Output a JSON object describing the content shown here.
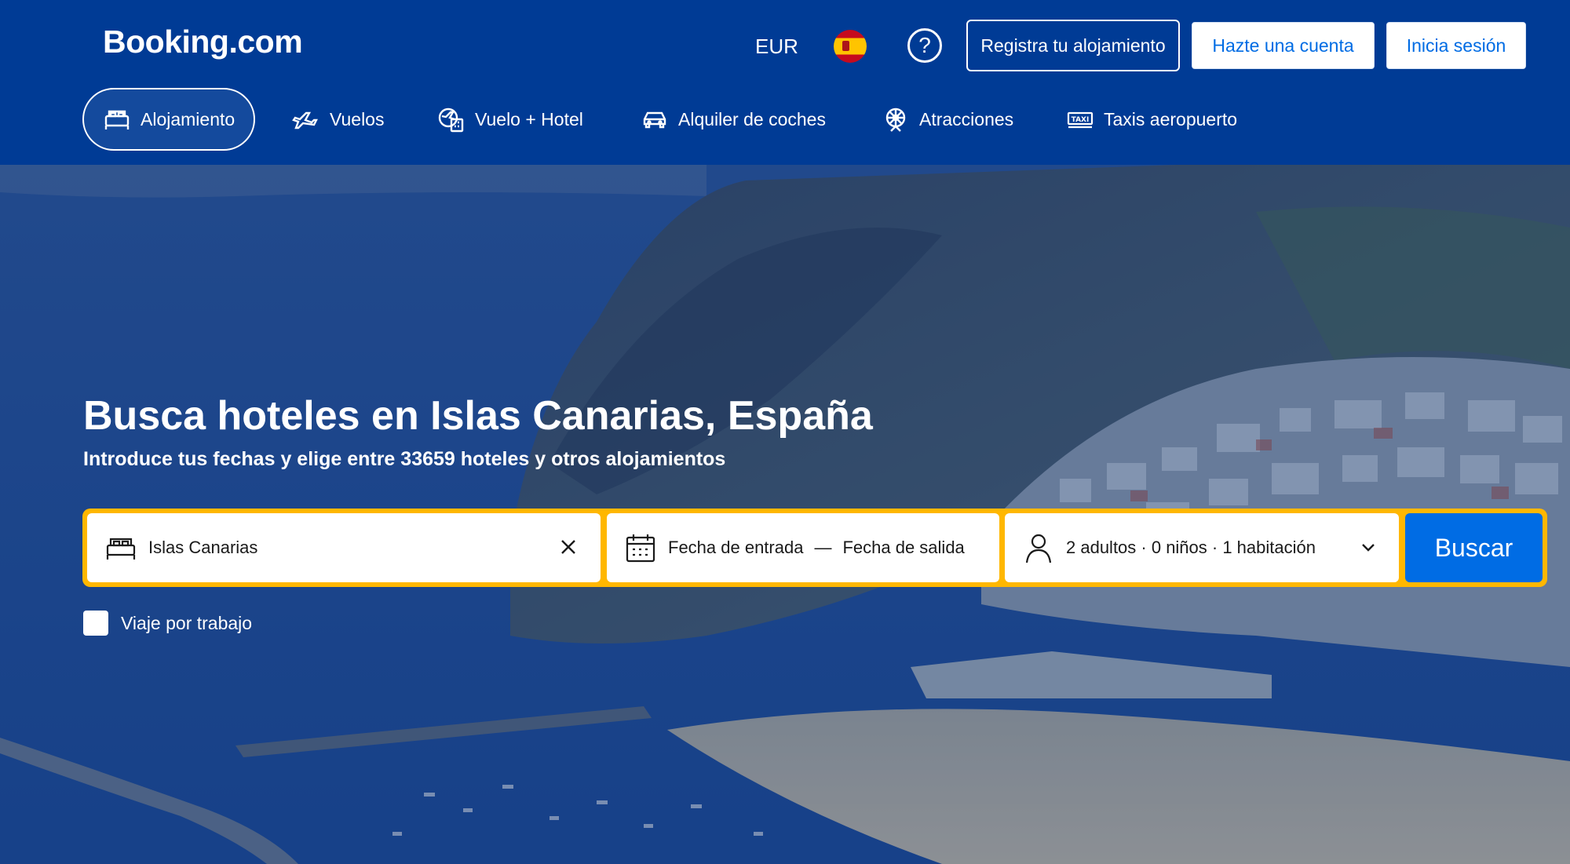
{
  "header": {
    "logo": "Booking.com",
    "currency": "EUR",
    "language_flag": "spain-flag",
    "help_symbol": "?",
    "list_property": "Registra tu alojamiento",
    "signup": "Hazte una cuenta",
    "login": "Inicia sesión"
  },
  "nav": {
    "items": [
      {
        "label": "Alojamiento",
        "icon": "bed-icon",
        "active": true
      },
      {
        "label": "Vuelos",
        "icon": "plane-icon"
      },
      {
        "label": "Vuelo + Hotel",
        "icon": "flight-hotel-icon"
      },
      {
        "label": "Alquiler de coches",
        "icon": "car-icon"
      },
      {
        "label": "Atracciones",
        "icon": "attractions-icon"
      },
      {
        "label": "Taxis aeropuerto",
        "icon": "taxi-icon"
      }
    ]
  },
  "hero": {
    "title": "Busca hoteles en Islas Canarias, España",
    "subtitle": "Introduce tus fechas y elige entre 33659 hoteles y otros alojamientos"
  },
  "search": {
    "destination": "Islas Canarias",
    "checkin": "Fecha de entrada",
    "separator": "—",
    "checkout": "Fecha de salida",
    "guests": "2 adultos · 0 niños · 1 habitación",
    "button": "Buscar",
    "work_trip": "Viaje por trabajo"
  },
  "colors": {
    "brand_blue": "#003b95",
    "accent_blue": "#006ce4",
    "search_border": "#ffb700"
  }
}
